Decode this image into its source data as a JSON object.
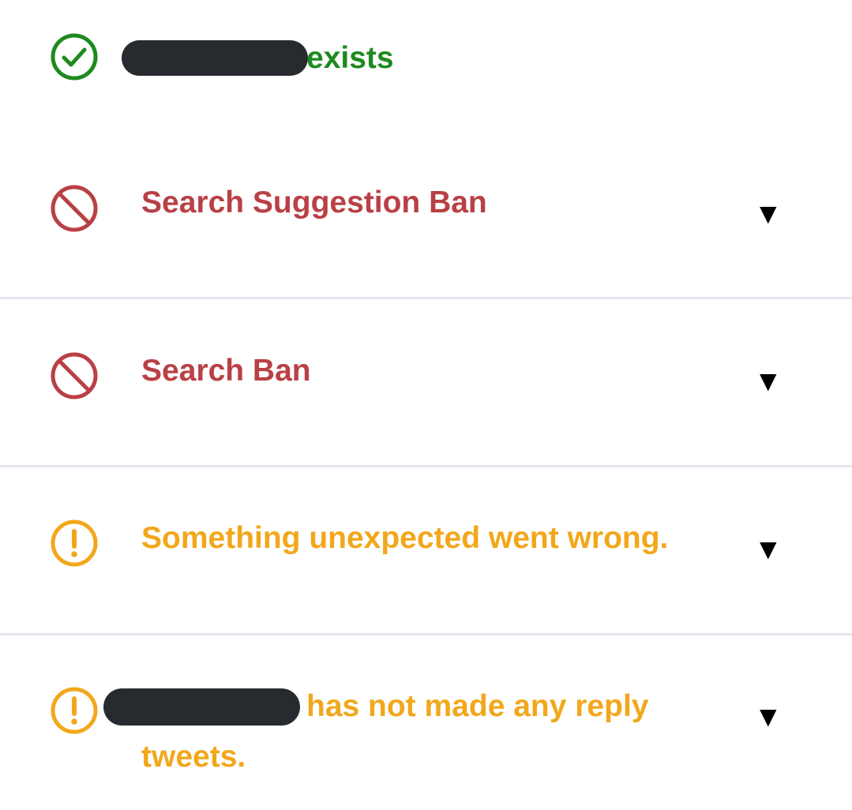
{
  "colors": {
    "success": "#1e8a1e",
    "danger": "#b94045",
    "warning": "#f2a71b",
    "redaction": "#272b30"
  },
  "rows": [
    {
      "status": "success",
      "icon": "check-circle-icon",
      "text": "exists",
      "has_redacted_username": true
    },
    {
      "status": "danger",
      "icon": "ban-icon",
      "text": "Search Suggestion Ban",
      "expand": "▼"
    },
    {
      "status": "danger",
      "icon": "ban-icon",
      "text": "Search Ban",
      "expand": "▼"
    },
    {
      "status": "warning",
      "icon": "exclamation-circle-icon",
      "text": "Something unexpected went wrong.",
      "expand": "▼"
    },
    {
      "status": "warning",
      "icon": "exclamation-circle-icon",
      "text_line1": "has not made any reply",
      "text_line2": "tweets.",
      "has_redacted_username": true,
      "expand": "▼"
    }
  ]
}
